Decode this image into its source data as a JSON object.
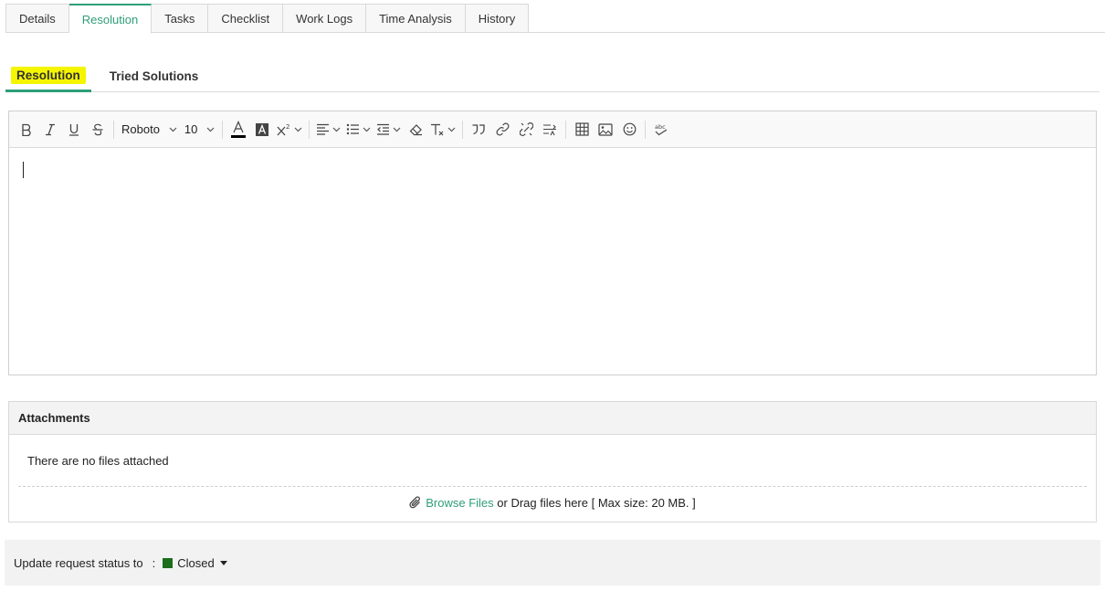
{
  "top_tabs": [
    {
      "label": "Details"
    },
    {
      "label": "Resolution"
    },
    {
      "label": "Tasks"
    },
    {
      "label": "Checklist"
    },
    {
      "label": "Work Logs"
    },
    {
      "label": "Time Analysis"
    },
    {
      "label": "History"
    }
  ],
  "sub_tabs": [
    {
      "label": "Resolution"
    },
    {
      "label": "Tried Solutions"
    }
  ],
  "editor": {
    "font_family_value": "Roboto",
    "font_size_value": "10",
    "font_color": "#000000",
    "content": ""
  },
  "attachments": {
    "title": "Attachments",
    "empty_text": "There are no files attached",
    "browse_label": "Browse Files",
    "drag_text": "or Drag files here [ Max size: 20 MB. ]"
  },
  "status": {
    "label": "Update request status to",
    "separator": ":",
    "value": "Closed",
    "color": "#1b6e1b"
  },
  "colors": {
    "accent": "#2f9e78",
    "highlight": "#f5f500"
  }
}
